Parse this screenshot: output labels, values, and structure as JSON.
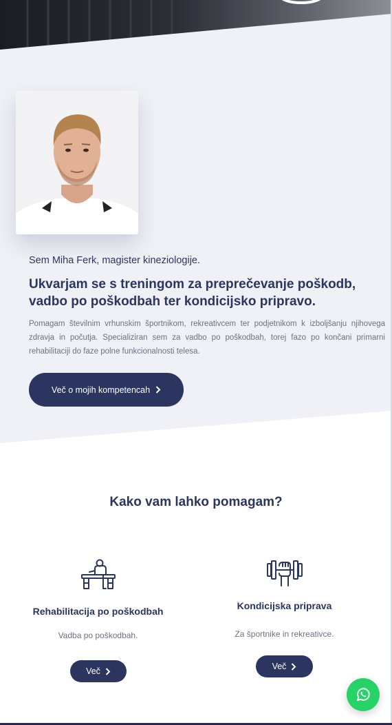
{
  "about": {
    "intro": "Sem Miha Ferk, magister kineziologije.",
    "headline": "Ukvarjam se s treningom za preprečevanje poškodb, vadbo po poškodbah ter kondicijsko pripravo.",
    "description": "Pomagam številnim vrhunskim športnikom, rekreativcem ter podjetnikom k izboljšanju njihovega zdravja in počutja. Specializiran sem za vadbo po poškodbah, torej fazo po končani primarni rehabilitaciji do faze polne funkcionalnosti telesa.",
    "button_label": "Več o mojih kompetencah"
  },
  "services": {
    "title": "Kako vam lahko pomagam?",
    "items": [
      {
        "title": "Rehabilitacija po poškodbah",
        "text": "Vadba po poškodbah.",
        "button_label": "Več",
        "icon": "rehab-bench-icon"
      },
      {
        "title": "Kondicijska priprava",
        "text": "Za športnike in rekreativce.",
        "button_label": "Več",
        "icon": "dumbbell-icon"
      }
    ]
  },
  "colors": {
    "primary": "#2c3560",
    "section_bg": "#eff1f7",
    "text_muted": "#6d7180",
    "whatsapp": "#25d366"
  },
  "icons": {
    "whatsapp": "whatsapp-icon",
    "chevron": "chevron-right-icon"
  }
}
